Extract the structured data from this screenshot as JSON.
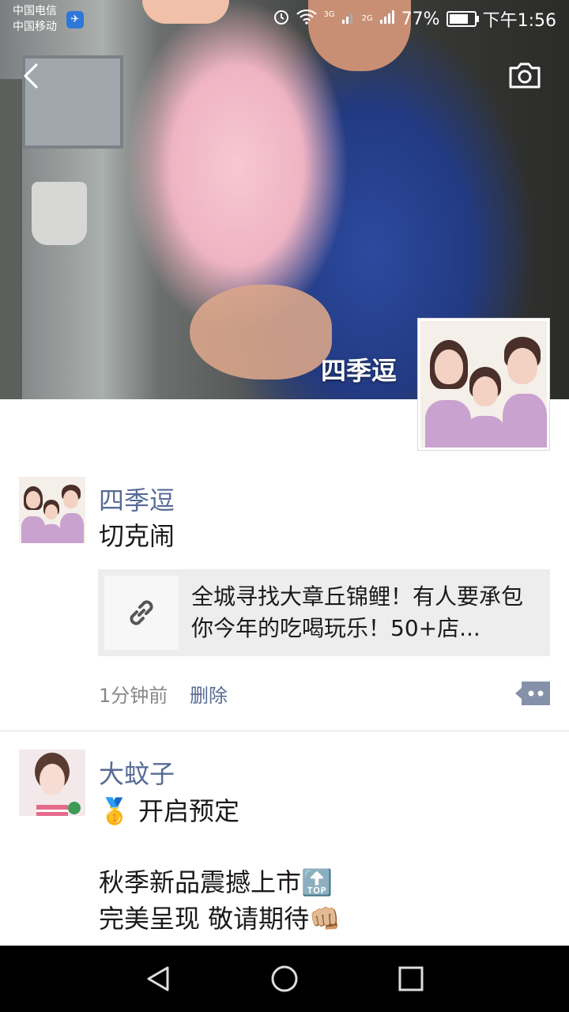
{
  "status_bar": {
    "carrier_1": "中国电信",
    "carrier_2": "中国移动",
    "network_a": "3G",
    "network_b": "2G",
    "battery": "77%",
    "battery_level": 0.77,
    "time": "下午1:56"
  },
  "cover": {
    "owner_name": "四季逗"
  },
  "posts": [
    {
      "author": "四季逗",
      "text": "切克闹",
      "link_title": "全城寻找大章丘锦鲤！有人要承包你今年的吃喝玩乐！50+店...",
      "time": "1分钟前",
      "delete_label": "删除"
    },
    {
      "author": "大蚊子",
      "line_1": "🥇 开启预定",
      "line_2": "秋季新品震撼上市🔝",
      "line_3": "完美呈现 敬请期待👊🏼"
    }
  ],
  "colors": {
    "name_blue": "#576b95",
    "nav_bg": "#000000"
  }
}
